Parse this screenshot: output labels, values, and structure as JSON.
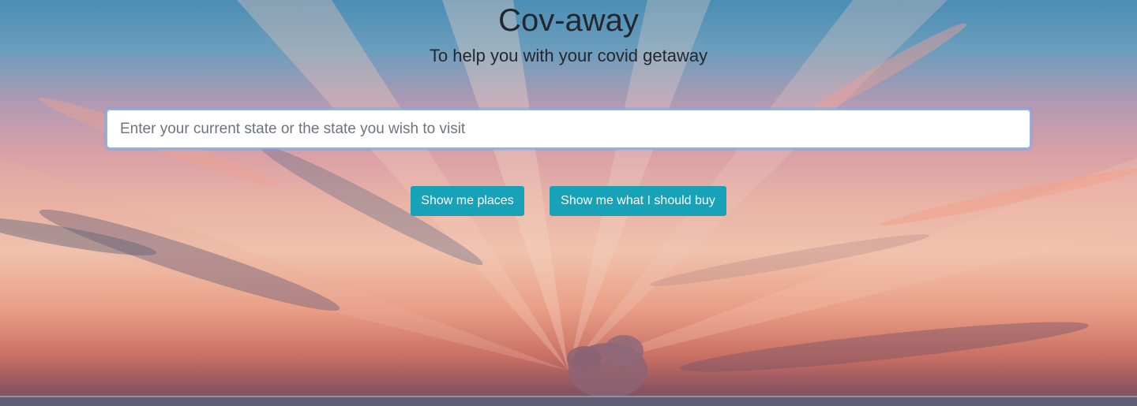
{
  "header": {
    "title": "Cov-away",
    "subtitle": "To help you with your covid getaway"
  },
  "search": {
    "placeholder": "Enter your current state or the state you wish to visit",
    "value": ""
  },
  "actions": {
    "places_label": "Show me places",
    "buy_label": "Show me what I should buy"
  },
  "theme": {
    "button_color": "#17a2b8",
    "button_text_color": "#ffffff",
    "title_color": "#23272e"
  }
}
